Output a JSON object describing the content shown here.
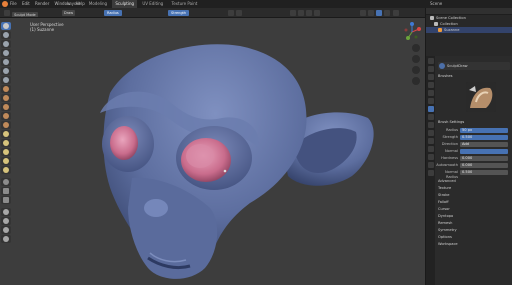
{
  "app": {
    "name": "Blender"
  },
  "menu": [
    "File",
    "Edit",
    "Render",
    "Window",
    "Help"
  ],
  "workspaces": [
    {
      "label": "Layout",
      "active": false
    },
    {
      "label": "Modeling",
      "active": false
    },
    {
      "label": "Sculpting",
      "active": true
    },
    {
      "label": "UV Editing",
      "active": false
    },
    {
      "label": "Texture Paint",
      "active": false
    }
  ],
  "scene_label": "Scene",
  "toolhead": {
    "mode": "Sculpt Mode",
    "brush": "Draw",
    "radius": "Radius",
    "strength": "Strength"
  },
  "viewport": {
    "view_name": "User Perspective",
    "object_name": "(1) Suzanne"
  },
  "outliner": {
    "items": [
      {
        "label": "Scene Collection",
        "icon": "collection-icon",
        "selected": false
      },
      {
        "label": "Collection",
        "icon": "collection-icon",
        "selected": false
      },
      {
        "label": "Suzanne",
        "icon": "mesh-icon",
        "selected": true
      }
    ]
  },
  "properties": {
    "brush_name": "SculptDraw",
    "brush_section": "Brushes",
    "settings_section": "Brush Settings",
    "fields": [
      {
        "label": "Radius",
        "value": "50 px",
        "highlight": true
      },
      {
        "label": "Strength",
        "value": "0.500",
        "highlight": true
      },
      {
        "label": "Direction",
        "value": "Add",
        "highlight": false
      },
      {
        "label": "Normal",
        "value": "",
        "highlight": false
      },
      {
        "label": "Hardness",
        "value": "0.000",
        "highlight": false
      },
      {
        "label": "Autosmooth",
        "value": "0.000",
        "highlight": false
      },
      {
        "label": "Normal Radius",
        "value": "0.500",
        "highlight": false
      }
    ],
    "panels": [
      "Advanced",
      "Texture",
      "Stroke",
      "Falloff",
      "Cursor",
      "Dyntopo",
      "Remesh",
      "Symmetry",
      "Options",
      "Workspace"
    ]
  },
  "colors": {
    "accent": "#4772b3",
    "model": "#5d6e9f",
    "eyes": "#c96c8c",
    "background": "#3d3d3d"
  }
}
